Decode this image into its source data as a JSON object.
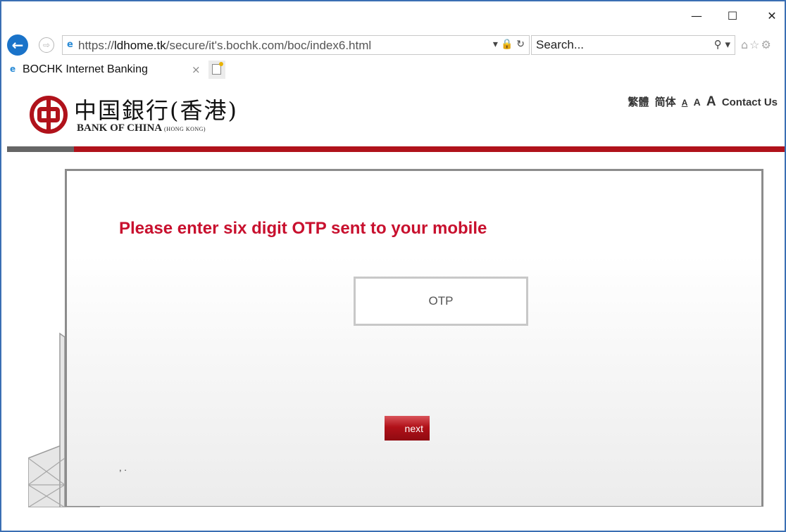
{
  "window": {
    "controls": {
      "minimize": "—",
      "maximize": "☐",
      "close": "✕"
    }
  },
  "browser": {
    "back_icon": "back-arrow-icon",
    "forward_icon": "forward-arrow-icon",
    "address": {
      "prefix": "https://",
      "host": "ldhome.tk",
      "path": "/secure/it's.bochk.com/boc/index6.html",
      "controls": "▾ 🔒 ↻"
    },
    "search": {
      "placeholder": "Search...",
      "controls": "⚲ ▾"
    },
    "tool_icons": "⌂☆⚙"
  },
  "tab": {
    "title": "BOCHK Internet Banking",
    "close": "×"
  },
  "header": {
    "logo_cn": "中国銀行(香港)",
    "logo_en_main": "BANK OF CHINA",
    "logo_en_sub": "(HONG KONG)",
    "lang_traditional": "繁體",
    "lang_simplified": "简体",
    "font_small": "A",
    "font_medium": "A",
    "font_large": "A",
    "contact": "Contact Us"
  },
  "colors": {
    "brand_red": "#c8102e",
    "bar_red": "#b0121b",
    "browser_blue": "#1a73c9"
  },
  "main": {
    "heading": "Please enter six digit OTP sent to your mobile",
    "otp_placeholder": "OTP",
    "next_label": "next",
    "footnote": ", ."
  }
}
